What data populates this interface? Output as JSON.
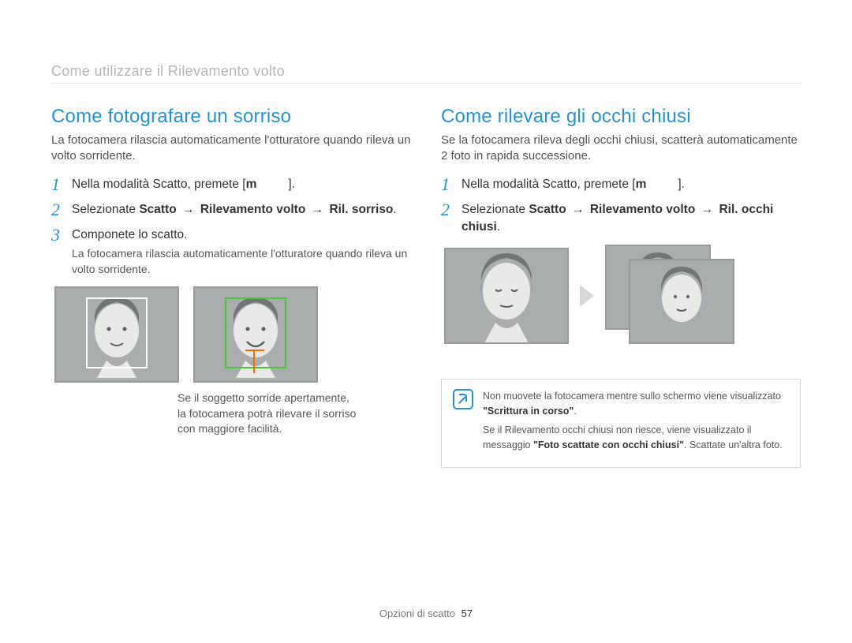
{
  "breadcrumb": "Come utilizzare il Rilevamento volto",
  "left": {
    "title": "Come fotografare un sorriso",
    "intro": "La fotocamera rilascia automaticamente l'otturatore quando rileva un volto sorridente.",
    "step1_prefix": "Nella modalità Scatto, premete [",
    "step1_key": "m",
    "step1_suffix": "].",
    "step2_prefix": "Selezionate ",
    "step2_path1": "Scatto",
    "step2_path2": "Rilevamento volto",
    "step2_path3": "Ril. sorriso",
    "step2_arrow": "→",
    "step2_end": ".",
    "step3": "Componete lo scatto.",
    "step3_sub": "La fotocamera rilascia automaticamente l'otturatore quando rileva un volto sorridente.",
    "caption": "Se il soggetto sorride apertamente, la fotocamera potrà rilevare il sorriso con maggiore facilità."
  },
  "right": {
    "title": "Come rilevare gli occhi chiusi",
    "intro": "Se la fotocamera rileva degli occhi chiusi, scatterà automaticamente 2 foto in rapida successione.",
    "step1_prefix": "Nella modalità Scatto, premete [",
    "step1_key": "m",
    "step1_suffix": "].",
    "step2_prefix": "Selezionate ",
    "step2_path1": "Scatto",
    "step2_path2": "Rilevamento volto",
    "step2_path3": "Ril. occhi chiusi",
    "step2_arrow": "→",
    "step2_end": ".",
    "note1_a": "Non muovete la fotocamera mentre sullo schermo viene visualizzato ",
    "note1_b": "\"Scrittura in corso\"",
    "note1_c": ".",
    "note2_a": "Se il Rilevamento occhi chiusi non riesce, viene visualizzato il messaggio ",
    "note2_b": "\"Foto scattate con occhi chiusi\"",
    "note2_c": ". Scattate un'altra foto."
  },
  "footer": {
    "section": "Opzioni di scatto",
    "page": "57"
  }
}
